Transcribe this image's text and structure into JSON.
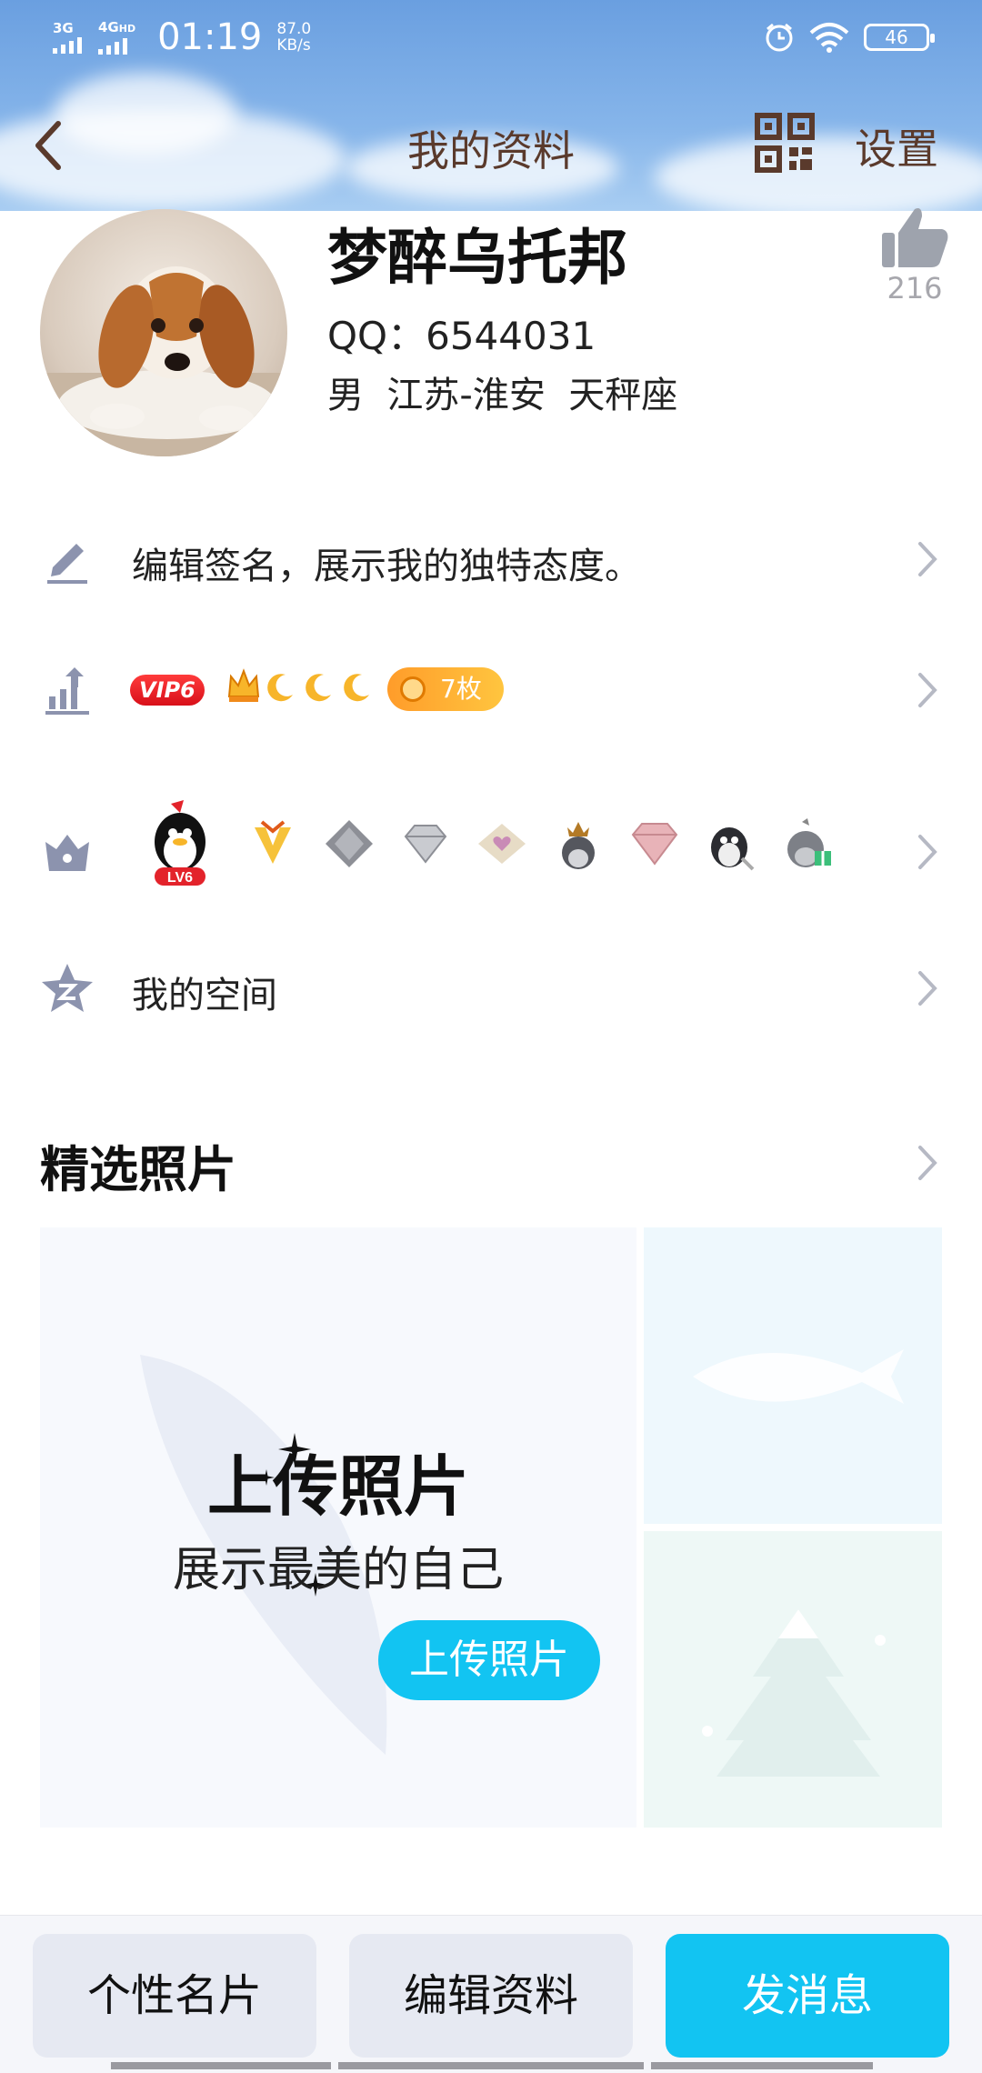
{
  "status_bar": {
    "net1": "3G",
    "net2": "4G",
    "net2_sup": "HD",
    "time": "01:19",
    "speed_value": "87.0",
    "speed_unit": "KB/s",
    "battery": "46"
  },
  "header": {
    "title": "我的资料",
    "settings_label": "设置"
  },
  "profile": {
    "nickname": "梦醉乌托邦",
    "qq": "QQ：6544031",
    "info": "男  江苏-淮安  天秤座",
    "likes": "216"
  },
  "rows": {
    "signature": "编辑签名，展示我的独特态度。",
    "vip_label": "VIP6",
    "medal_count": "7枚",
    "level_label": "LV6",
    "qzone": "我的空间"
  },
  "photos": {
    "section_title": "精选照片",
    "upload_title": "上传照片",
    "upload_subtitle": "展示最美的自己",
    "upload_button": "上传照片"
  },
  "bottom_bar": {
    "card": "个性名片",
    "edit": "编辑资料",
    "message": "发消息"
  },
  "colors": {
    "accent": "#12c4f2",
    "title_brown": "#5a3a2c",
    "row_icon": "#8c93ae"
  }
}
